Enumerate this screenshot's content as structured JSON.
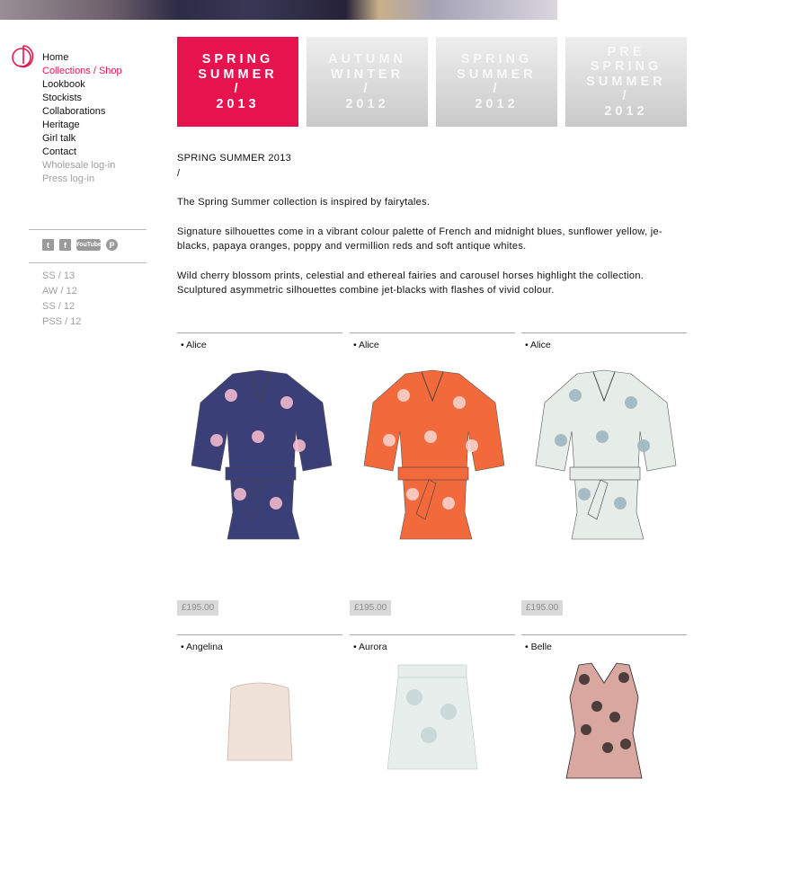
{
  "colors": {
    "accent": "#e6134e",
    "muted": "#a0a0a0",
    "tile_inactive": "#cfcfcf"
  },
  "nav": {
    "items": [
      {
        "label": "Home",
        "state": "normal"
      },
      {
        "label": "Collections / Shop",
        "state": "active"
      },
      {
        "label": "Lookbook",
        "state": "normal"
      },
      {
        "label": "Stockists",
        "state": "normal"
      },
      {
        "label": "Collaborations",
        "state": "normal"
      },
      {
        "label": "Heritage",
        "state": "normal"
      },
      {
        "label": "Girl talk",
        "state": "normal"
      },
      {
        "label": "Contact",
        "state": "normal"
      },
      {
        "label": "Wholesale log-in",
        "state": "muted"
      },
      {
        "label": "Press log-in",
        "state": "muted"
      }
    ]
  },
  "social": {
    "twitter": "t",
    "facebook": "f",
    "youtube": "YouTube",
    "pinterest": "P",
    "icons": [
      "twitter-icon",
      "facebook-icon",
      "youtube-icon",
      "pinterest-icon"
    ]
  },
  "seasons": [
    "SS / 13",
    "AW / 12",
    "SS / 12",
    "PSS / 12"
  ],
  "tiles": [
    {
      "label": "SPRING\nSUMMER\n/\n2013",
      "active": true
    },
    {
      "label": "AUTUMN\nWINTER\n/\n2012",
      "active": false
    },
    {
      "label": "SPRING\nSUMMER\n/\n2012",
      "active": false
    },
    {
      "label": "PRE\nSPRING\nSUMMER\n/\n2012",
      "active": false
    }
  ],
  "intro": {
    "heading": "SPRING SUMMER 2013",
    "slash": "/",
    "p1": "The Spring Summer collection is inspired by fairytales.",
    "p2": "Signature silhouettes come in a vibrant colour palette of French and midnight blues, sunflower yellow, je-blacks, papaya oranges, poppy and vermillion reds and soft antique whites.",
    "p3": "Wild cherry blossom prints, celestial and ethereal fairies and carousel horses highlight the collection. Sculptured asymmetric silhouettes combine jet-blacks with flashes of vivid colour."
  },
  "products": [
    {
      "name": "• Alice",
      "price": "£195.00",
      "color": "#3b3f78",
      "accent": "#f1b8cb",
      "kind": "blouse"
    },
    {
      "name": "• Alice",
      "price": "£195.00",
      "color": "#f26a3c",
      "accent": "#f8d0c8",
      "kind": "blouse"
    },
    {
      "name": "• Alice",
      "price": "£195.00",
      "color": "#e6ece8",
      "accent": "#9fb7c0",
      "kind": "blouse"
    },
    {
      "name": "• Angelina",
      "price": "",
      "color": "#f0e2d8",
      "accent": "#d8c2b0",
      "kind": "bustier"
    },
    {
      "name": "• Aurora",
      "price": "",
      "color": "#e7eeeb",
      "accent": "#a9c3c6",
      "kind": "skirt"
    },
    {
      "name": "• Belle",
      "price": "",
      "color": "#d8a8a0",
      "accent": "#2a2222",
      "kind": "dress"
    }
  ]
}
